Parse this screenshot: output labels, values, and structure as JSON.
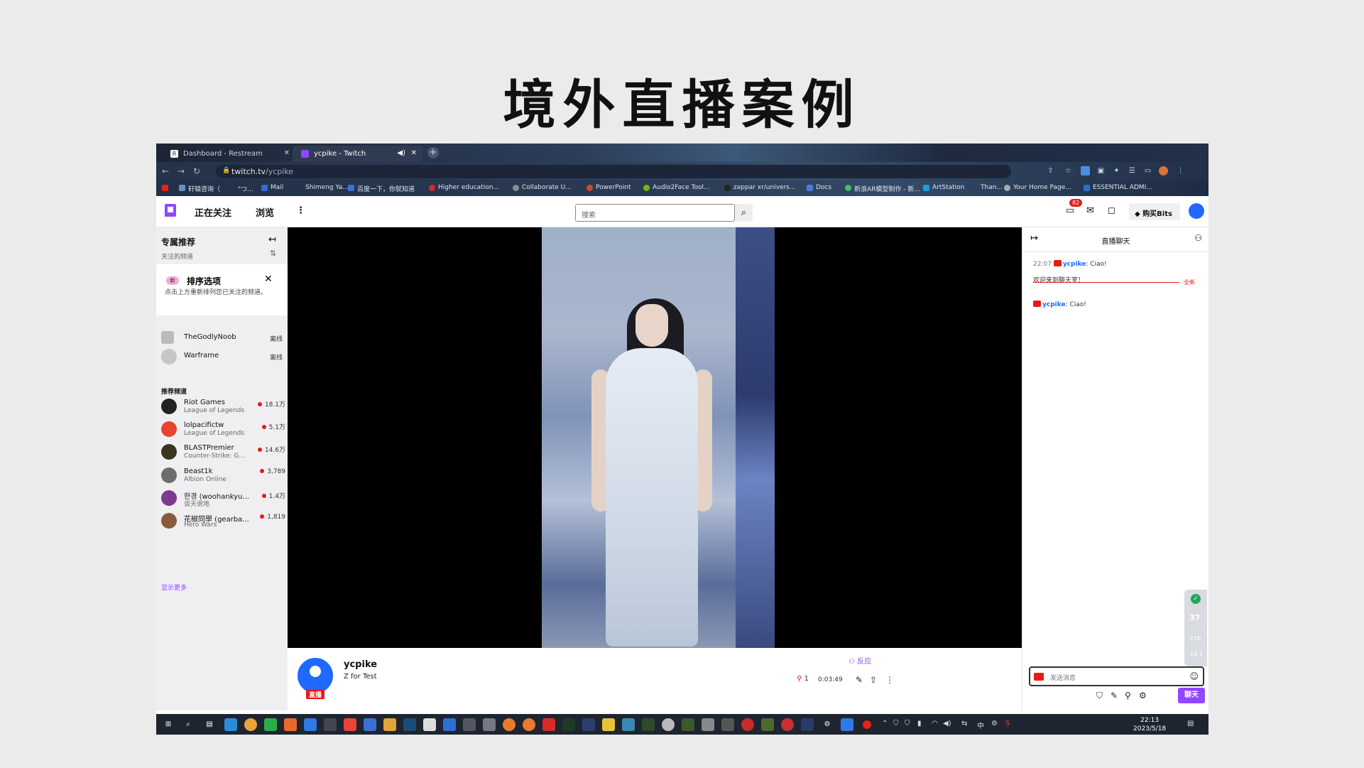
{
  "slide": {
    "title": "境外直播案例"
  },
  "browser": {
    "tabs": [
      {
        "label": "Dashboard - Restream"
      },
      {
        "label": "ycpike - Twitch"
      }
    ],
    "url_host": "twitch.tv",
    "url_path": "/ycpike",
    "bookmarks": [
      "轩辕咨询（",
      "\"つ...",
      "Mail",
      "Shimeng Ya...",
      "百度一下，你就知道",
      "Higher education...",
      "Collaborate U...",
      "PowerPoint",
      "Audio2Face Tool...",
      "zappar xr/univers...",
      "Docs",
      "新浪AR模型制作 - 新...",
      "ArtStation",
      "Than...",
      "Your Home Page...",
      "ESSENTIAL ADMI..."
    ]
  },
  "twitch_nav": {
    "following": "正在关注",
    "browse": "浏览",
    "search_placeholder": "搜索",
    "notif_count": "82",
    "buy_coins": "购买Bits"
  },
  "sidebar": {
    "heading": "专属推荐",
    "sub": "关注的频道",
    "sort_card": {
      "badge": "新",
      "title": "排序选项",
      "desc": "点击上方重新排列您已关注的频道。"
    },
    "followed": [
      {
        "name": "TheGodlyNoob",
        "status": "离线"
      },
      {
        "name": "Warframe",
        "status": "离线"
      }
    ],
    "rec_heading": "推荐频道",
    "recommended": [
      {
        "name": "Riot Games",
        "game": "League of Legends",
        "viewers": "18.1万"
      },
      {
        "name": "lolpacifictw",
        "game": "League of Legends",
        "viewers": "5.1万"
      },
      {
        "name": "BLASTPremier",
        "game": "Counter-Strike: G...",
        "viewers": "14.6万"
      },
      {
        "name": "Beast1k",
        "game": "Albion Online",
        "viewers": "3,789"
      },
      {
        "name": "한경 (woohankyu...",
        "game": "谈天说地",
        "viewers": "1.4万"
      },
      {
        "name": "花椒同學 (gearba...",
        "game": "Hero Wars",
        "viewers": "1,819"
      }
    ],
    "show_more": "显示更多"
  },
  "stream": {
    "live_badge": "直播",
    "name": "ycpike",
    "title": "Z for Test",
    "react": "反应",
    "viewers": "1",
    "uptime": "0:03:49"
  },
  "chat": {
    "header": "直播聊天",
    "messages": [
      {
        "time": "22:07",
        "user": "ycpike",
        "text": ": Ciao!"
      },
      {
        "system": "欢迎来到聊天室！"
      },
      {
        "user": "ycpike",
        "text": ": Ciao!"
      }
    ],
    "new_label": "全新",
    "input_placeholder": "发送消息",
    "chat_button": "聊天",
    "score": {
      "count": "37",
      "a": "216",
      "b": "14.1"
    }
  },
  "taskbar": {
    "ime": "中",
    "time": "22:13",
    "date": "2023/5/18"
  }
}
